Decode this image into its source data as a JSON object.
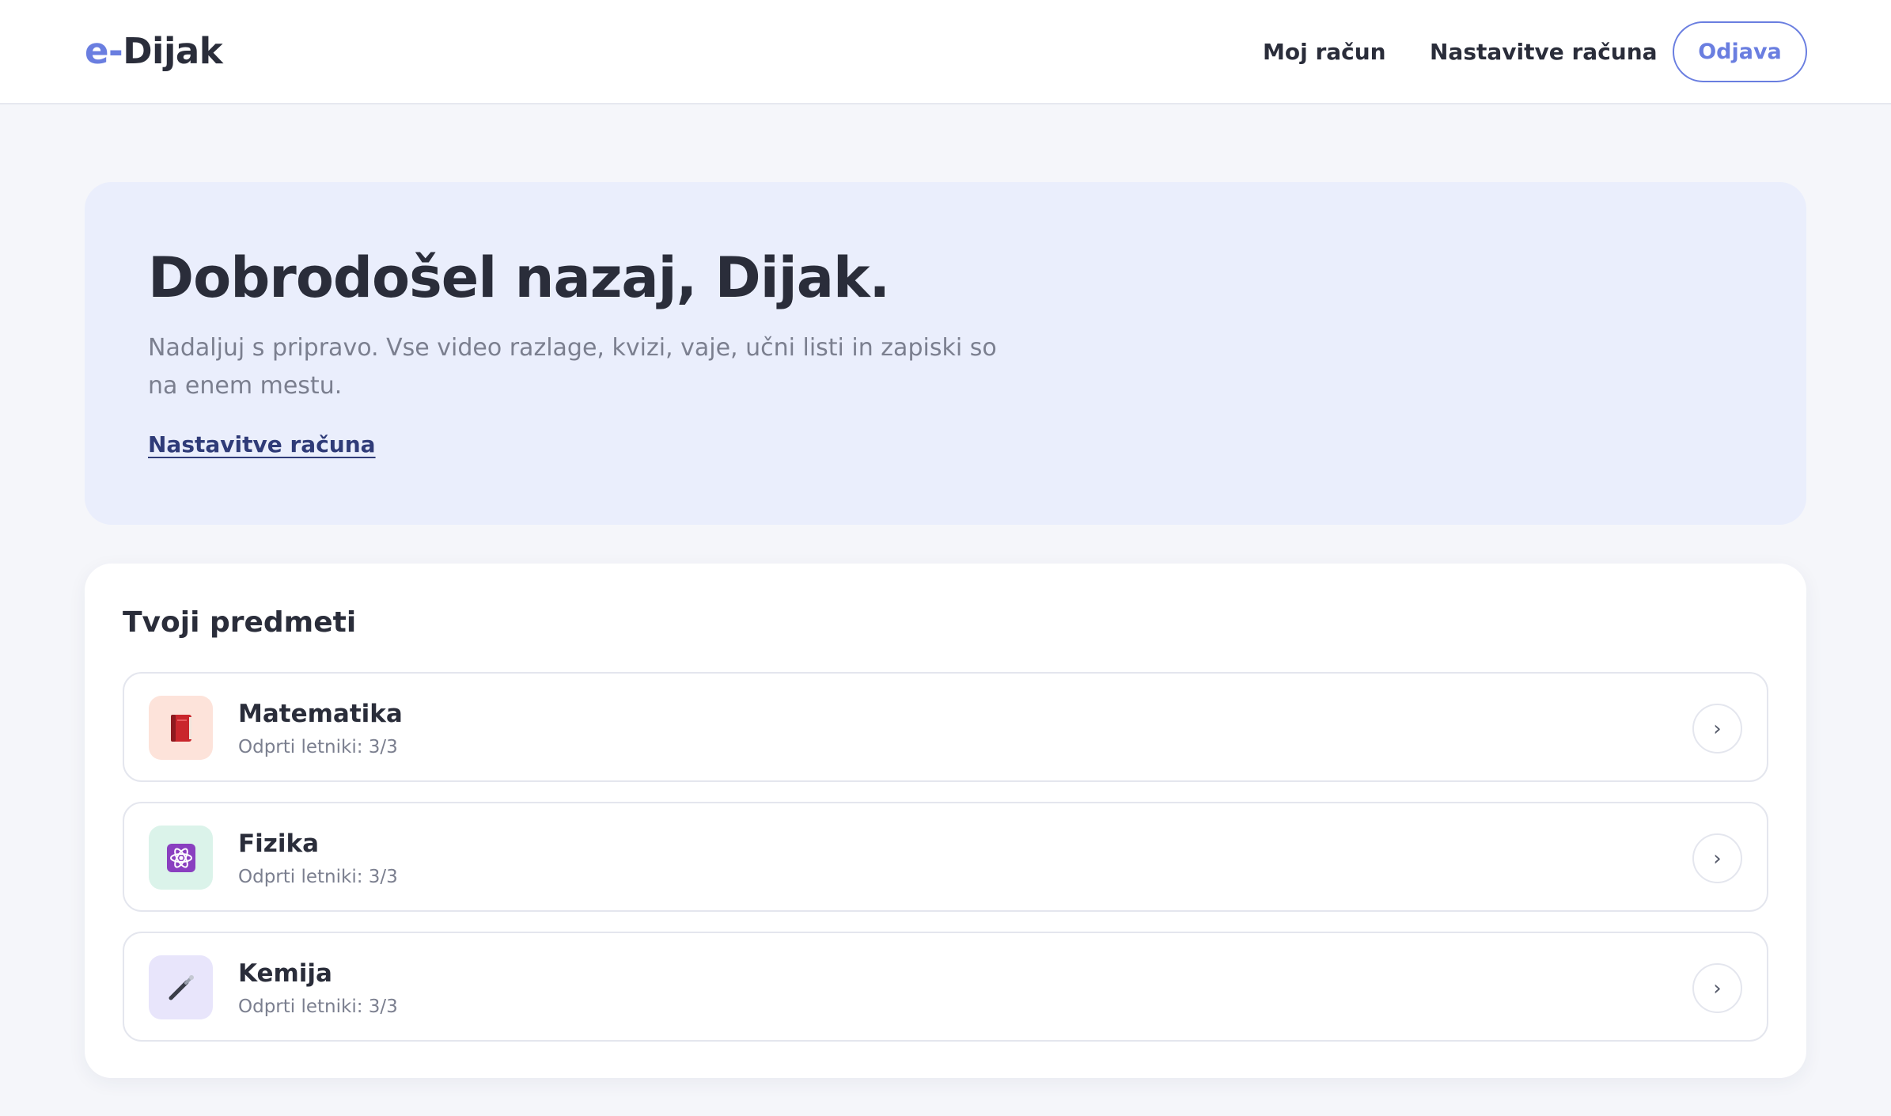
{
  "header": {
    "logo_prefix": "e-",
    "logo_name": "Dijak",
    "nav": {
      "account": "Moj račun",
      "settings": "Nastavitve računa",
      "logout": "Odjava"
    }
  },
  "hero": {
    "title": "Dobrodošel nazaj, Dijak.",
    "text": "Nadaljuj s pripravo. Vse video razlage, kvizi, vaje, učni listi in zapiski so na enem mestu.",
    "link": "Nastavitve računa"
  },
  "subjects": {
    "title": "Tvoji predmeti",
    "items": [
      {
        "name": "Matematika",
        "meta": "Odprti letniki: 3/3",
        "icon": "book-icon",
        "icon_bg": "#fde3da"
      },
      {
        "name": "Fizika",
        "meta": "Odprti letniki: 3/3",
        "icon": "atom-icon",
        "icon_bg": "#dbf3ea"
      },
      {
        "name": "Kemija",
        "meta": "Odprti letniki: 3/3",
        "icon": "pipette-icon",
        "icon_bg": "#e8e5fb"
      }
    ],
    "chevron": "›"
  },
  "colors": {
    "accent": "#6a7ee0",
    "hero_bg": "#eaeefc",
    "page_bg": "#f5f6fa",
    "link": "#2f3b78"
  }
}
